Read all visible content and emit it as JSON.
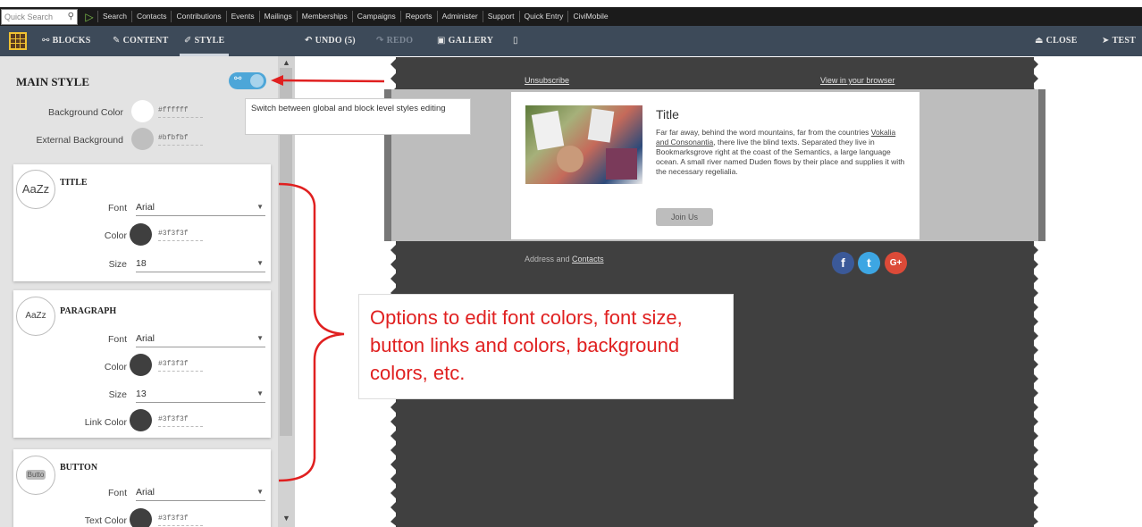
{
  "civi_menu": {
    "quick_search": "Quick Search",
    "items": [
      "Search",
      "Contacts",
      "Contributions",
      "Events",
      "Mailings",
      "Memberships",
      "Campaigns",
      "Reports",
      "Administer",
      "Support",
      "Quick Entry",
      "CiviMobile"
    ]
  },
  "toolbar": {
    "blocks": "BLOCKS",
    "content": "CONTENT",
    "style": "STYLE",
    "undo": "UNDO (5)",
    "redo": "REDO",
    "gallery": "GALLERY",
    "close": "CLOSE",
    "test": "TEST"
  },
  "panel": {
    "title": "MAIN STYLE",
    "tooltip": "Switch between global and block level styles editing",
    "background_color": {
      "label": "Background Color",
      "value": "#ffffff",
      "swatch": "#ffffff"
    },
    "external_background": {
      "label": "External Background",
      "value": "#bfbfbf",
      "swatch": "#bfbfbf"
    },
    "title_section": {
      "badge": "AaZz",
      "heading": "TITLE",
      "font_label": "Font",
      "font_value": "Arial",
      "color_label": "Color",
      "color_value": "#3f3f3f",
      "size_label": "Size",
      "size_value": "18"
    },
    "paragraph_section": {
      "badge": "AaZz",
      "heading": "PARAGRAPH",
      "font_label": "Font",
      "font_value": "Arial",
      "color_label": "Color",
      "color_value": "#3f3f3f",
      "size_label": "Size",
      "size_value": "13",
      "link_color_label": "Link Color",
      "link_color_value": "#3f3f3f"
    },
    "button_section": {
      "badge": "Butto",
      "heading": "BUTTON",
      "font_label": "Font",
      "font_value": "Arial",
      "text_color_label": "Text Color",
      "text_color_value": "#3f3f3f"
    }
  },
  "email": {
    "unsubscribe": "Unsubscribe",
    "view_in_browser": "View in your browser",
    "title": "Title",
    "body_pre": "Far far away, behind the word mountains, far from the countries ",
    "body_link": "Vokalia and Consonantia",
    "body_post": ", there live the blind texts. Separated they live in Bookmarksgrove right at the coast of the Semantics, a large language ocean. A small river named Duden flows by their place and supplies it with the necessary regelialia.",
    "button": "Join Us",
    "address_pre": "Address and ",
    "address_link": "Contacts",
    "social": {
      "facebook": "f",
      "twitter": "t",
      "google": "G+"
    }
  },
  "annotation": {
    "text": "Options to edit font colors, font size, button links and colors, background colors, etc."
  },
  "colors": {
    "civi_bar": "#1b1b1b",
    "toolbar": "#3d4a59",
    "panel": "#e3e3e3",
    "email_dark": "#404040",
    "toggle": "#4da6d8",
    "annotation_red": "#e02020",
    "facebook": "#3b5998",
    "twitter": "#3da6e3",
    "google": "#dc4a38"
  }
}
